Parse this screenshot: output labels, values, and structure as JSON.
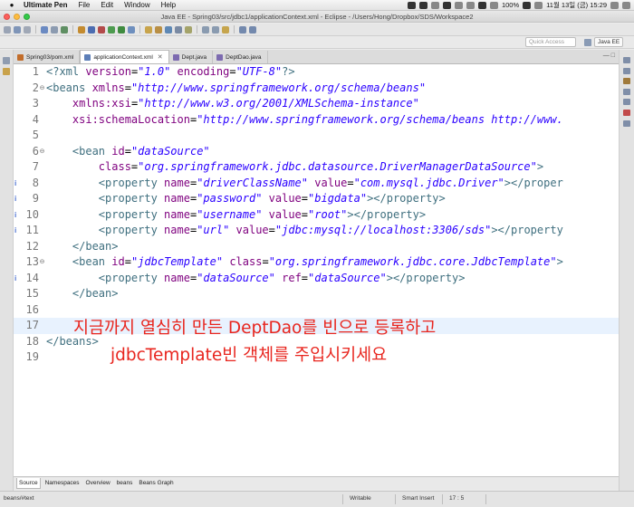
{
  "menubar": {
    "app_name": "Ultimate Pen",
    "items": [
      "File",
      "Edit",
      "Window",
      "Help"
    ],
    "battery": "100%",
    "datetime": "11월 13일 (금) 15:29"
  },
  "window": {
    "title": "Java EE - Spring03/src/jdbc1/applicationContext.xml - Eclipse - /Users/Hong/Dropbox/SDS/Workspace2"
  },
  "quick_access": {
    "placeholder": "Quick Access",
    "perspective": "Java EE"
  },
  "tabs": [
    {
      "label": "Spring03/pom.xml",
      "active": false,
      "icon_color": "#c26d2b"
    },
    {
      "label": "applicationContext.xml",
      "active": true,
      "icon_color": "#5d7fb8"
    },
    {
      "label": "Dept.java",
      "active": false,
      "icon_color": "#7d6bb0"
    },
    {
      "label": "DeptDao.java",
      "active": false,
      "icon_color": "#7d6bb0"
    }
  ],
  "editor": {
    "current_line": 17,
    "lines": [
      {
        "n": "1"
      },
      {
        "n": "2"
      },
      {
        "n": "3"
      },
      {
        "n": "4"
      },
      {
        "n": "5"
      },
      {
        "n": "6"
      },
      {
        "n": "7"
      },
      {
        "n": "8"
      },
      {
        "n": "9"
      },
      {
        "n": "10"
      },
      {
        "n": "11"
      },
      {
        "n": "12"
      },
      {
        "n": "13"
      },
      {
        "n": "14"
      },
      {
        "n": "15"
      },
      {
        "n": "16"
      },
      {
        "n": "17"
      },
      {
        "n": "18"
      },
      {
        "n": "19"
      }
    ],
    "code": {
      "l1": {
        "pi": "<?xml ",
        "a1": "version",
        "eq1": "=",
        "v1": "\"1.0\"",
        "a2": " encoding",
        "eq2": "=",
        "v2": "\"UTF-8\"",
        "end": "?>"
      },
      "l2": {
        "open": "<beans ",
        "a": "xmlns",
        "eq": "=",
        "v": "\"http://www.springframework.org/schema/beans\""
      },
      "l3": {
        "a": "xmlns:xsi",
        "eq": "=",
        "v": "\"http://www.w3.org/2001/XMLSchema-instance\""
      },
      "l4": {
        "a": "xsi:schemaLocation",
        "eq": "=",
        "v": "\"http://www.springframework.org/schema/beans http://www."
      },
      "l6": {
        "open": "<bean ",
        "a": "id",
        "eq": "=",
        "v": "\"dataSource\""
      },
      "l7": {
        "a": "class",
        "eq": "=",
        "v": "\"org.springframework.jdbc.datasource.DriverManagerDataSource\"",
        "end": ">"
      },
      "l8": {
        "open": "<property ",
        "a1": "name",
        "v1": "\"driverClassName\"",
        "a2": " value",
        "v2": "\"com.mysql.jdbc.Driver\"",
        "end": "></proper"
      },
      "l9": {
        "open": "<property ",
        "a1": "name",
        "v1": "\"password\"",
        "a2": " value",
        "v2": "\"bigdata\"",
        "end": "></property>"
      },
      "l10": {
        "open": "<property ",
        "a1": "name",
        "v1": "\"username\"",
        "a2": " value",
        "v2": "\"root\"",
        "end": "></property>"
      },
      "l11": {
        "open": "<property ",
        "a1": "name",
        "v1": "\"url\"",
        "a2": " value",
        "v2": "\"jdbc:mysql://localhost:3306/sds\"",
        "end": "></property"
      },
      "l12": {
        "close": "</bean>"
      },
      "l13": {
        "open": "<bean ",
        "a1": "id",
        "v1": "\"jdbcTemplate\"",
        "a2": " class",
        "v2": "\"org.springframework.jdbc.core.JdbcTemplate\"",
        "end": ">"
      },
      "l14": {
        "open": "<property ",
        "a1": "name",
        "v1": "\"dataSource\"",
        "a2": " ref",
        "v2": "\"dataSource\"",
        "end": "></property>"
      },
      "l15": {
        "close": "</bean>"
      },
      "l18": {
        "close": "</beans>"
      },
      "eq": "="
    }
  },
  "annotation": {
    "line1": "지금까지 열심히 만든 DeptDao를 빈으로 등록하고",
    "line2": "jdbcTemplate빈 객체를 주입시키세요"
  },
  "bottom_tabs": [
    "Source",
    "Namespaces",
    "Overview",
    "beans",
    "Beans Graph"
  ],
  "status": {
    "path": "beans/#text",
    "mode": "Writable",
    "insert": "Smart Insert",
    "position": "17 : 5"
  },
  "colors": {
    "annotation": "#e8251e",
    "current_line": "#e8f2fe",
    "tag": "#3f6f7f",
    "attr": "#7f007f",
    "value": "#2a00ff"
  }
}
